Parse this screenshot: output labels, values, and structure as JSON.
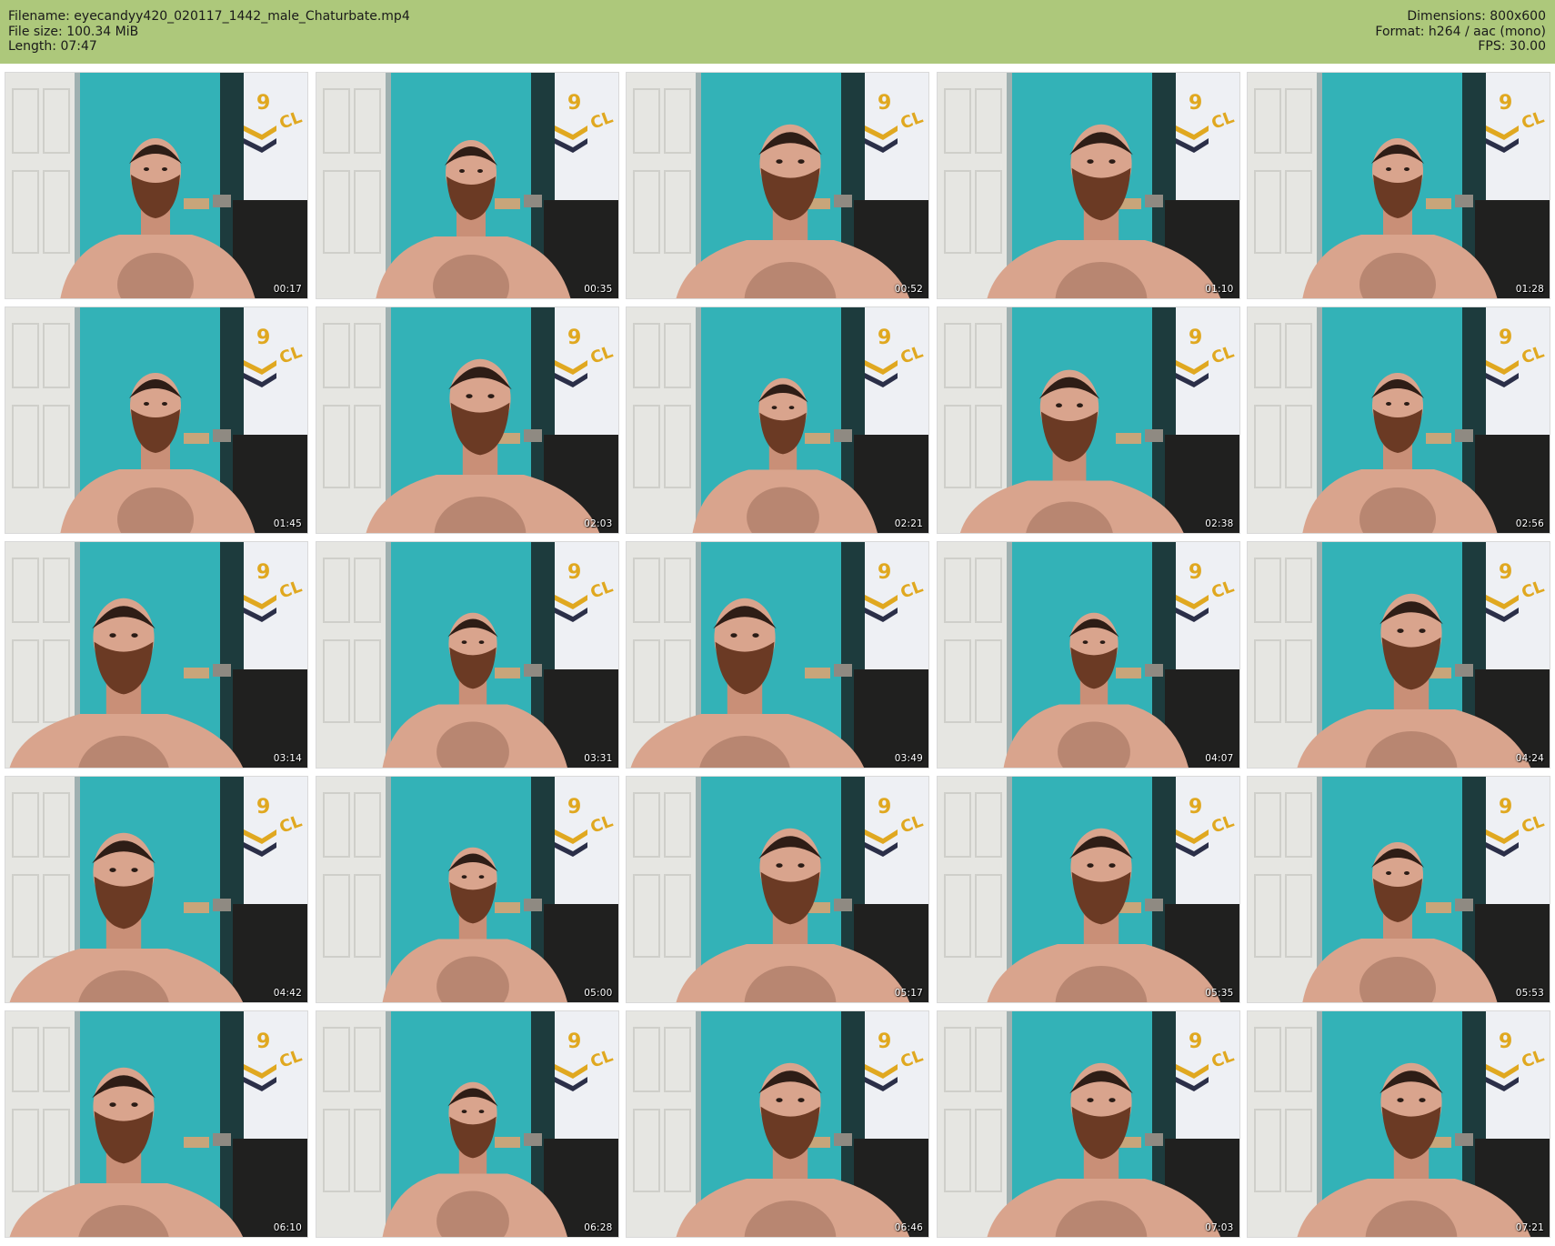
{
  "header": {
    "filename_line": "Filename: eyecandyy420_020117_1442_male_Chaturbate.mp4",
    "filesize_line": "File size: 100.34 MiB",
    "length_line": "Length: 07:47",
    "dimensions_line": "Dimensions: 800x600",
    "format_line": "Format: h264 / aac (mono)",
    "fps_line": "FPS: 30.00"
  },
  "colors": {
    "header_bg": "#adc87b",
    "wall": "#33b2b7",
    "skin": "#d9a48d",
    "beard": "#6b3a24"
  },
  "thumbnails": [
    {
      "timestamp": "00:17"
    },
    {
      "timestamp": "00:35"
    },
    {
      "timestamp": "00:52"
    },
    {
      "timestamp": "01:10"
    },
    {
      "timestamp": "01:28"
    },
    {
      "timestamp": "01:45"
    },
    {
      "timestamp": "02:03"
    },
    {
      "timestamp": "02:21"
    },
    {
      "timestamp": "02:38"
    },
    {
      "timestamp": "02:56"
    },
    {
      "timestamp": "03:14"
    },
    {
      "timestamp": "03:31"
    },
    {
      "timestamp": "03:49"
    },
    {
      "timestamp": "04:07"
    },
    {
      "timestamp": "04:24"
    },
    {
      "timestamp": "04:42"
    },
    {
      "timestamp": "05:00"
    },
    {
      "timestamp": "05:17"
    },
    {
      "timestamp": "05:35"
    },
    {
      "timestamp": "05:53"
    },
    {
      "timestamp": "06:10"
    },
    {
      "timestamp": "06:28"
    },
    {
      "timestamp": "06:46"
    },
    {
      "timestamp": "07:03"
    },
    {
      "timestamp": "07:21"
    }
  ]
}
